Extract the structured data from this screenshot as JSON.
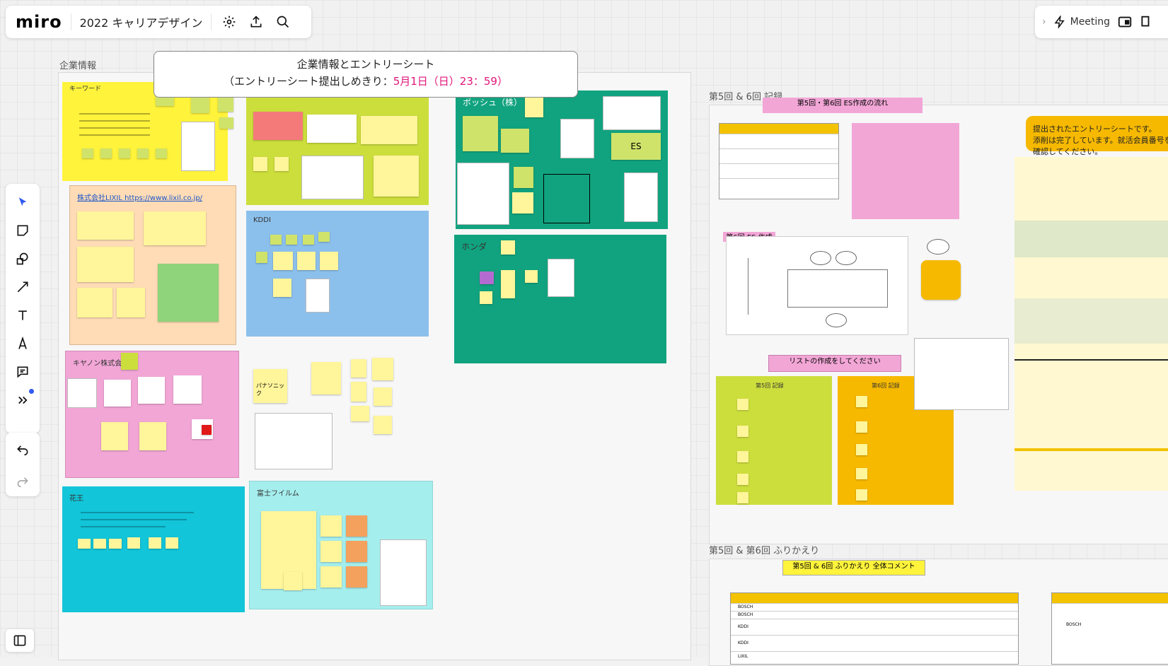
{
  "app": {
    "logo": "miro",
    "board_title": "2022 キャリアデザイン",
    "meeting_label": "Meeting"
  },
  "banner": {
    "line1": "企業情報とエントリーシート",
    "line2_prefix": "（エントリーシート提出しめきり：",
    "line2_deadline": "5月1日（日）23：59）"
  },
  "frames": {
    "left_label": "企業情報",
    "right_top_label": "第5回 & 6回 記録",
    "right_bottom_label": "第5回 & 第6回 ふりかえり"
  },
  "panels": {
    "keyword": "キーワード",
    "lixil": "株式会社LIXIL https://www.lixil.co.jp/",
    "kddi": "KDDI",
    "bosch": "ボッシュ（株）",
    "honda": "ホンダ",
    "canon": "キヤノン株式会社",
    "panasonic": "パナソニック",
    "ajinomoto": "花王",
    "fujifilm": "富士フイルム",
    "es": "ES"
  },
  "right_section": {
    "pink_header": "第5回・第6回 ES作成の流れ",
    "pink_label": "第6回 ES 作成会",
    "list_button": "リストの作成をしてください",
    "orange_note": "提出されたエントリーシートです。\n添削は完了しています。就活会員番号を確認してください。",
    "left_col_title": "第5回 記録",
    "right_col_title": "第6回 記録",
    "review_header": "第5回 & 6回 ふりかえり 全体コメント",
    "review_rows": [
      "BOSCH",
      "BOSCH",
      "KDDI",
      "KDDI",
      "LIXIL"
    ],
    "right_table_row": "BOSCH"
  },
  "colors": {
    "yellow": "#fff33b",
    "peach": "#ffdcb6",
    "lime": "#ccde3c",
    "blue": "#8cc0ec",
    "teal": "#11a37f",
    "pink": "#f2a6d6",
    "cyan": "#12c5d9",
    "lightcyan": "#a5eeee",
    "sticky": "#fff59a",
    "orange": "#f6b900",
    "accent_pink": "#e0157a"
  }
}
